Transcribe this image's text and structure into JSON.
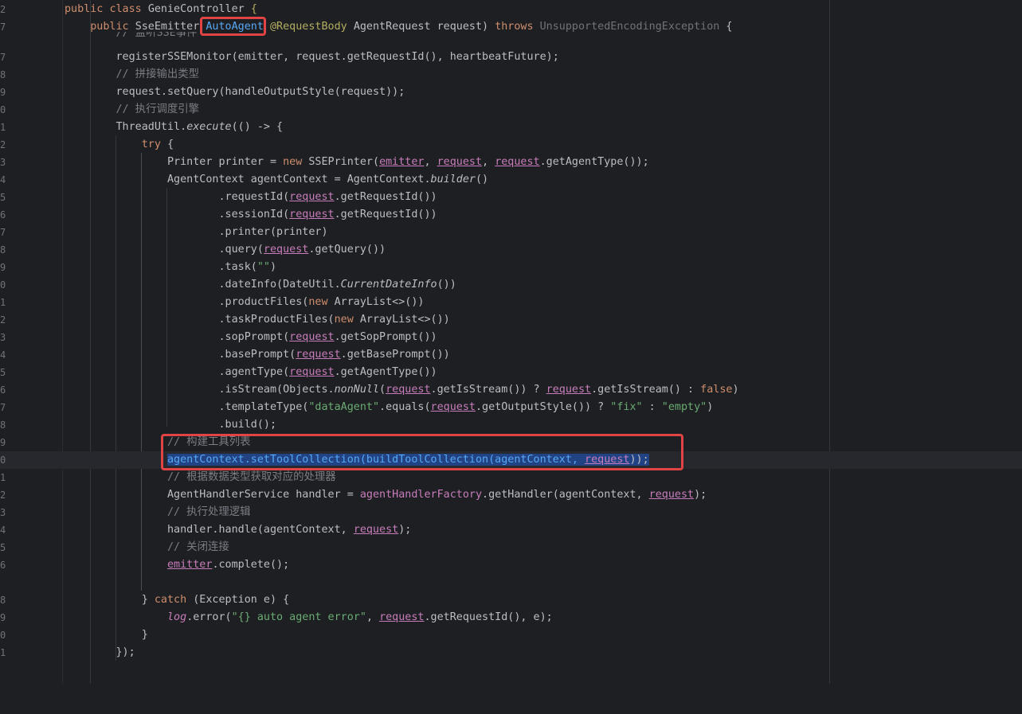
{
  "line_numbers": [
    "2",
    "7",
    "",
    "7",
    "8",
    "9",
    "0",
    "1",
    "2",
    "3",
    "4",
    "5",
    "6",
    "7",
    "8",
    "9",
    "0",
    "1",
    "2",
    "3",
    "4",
    "5",
    "6",
    "7",
    "8",
    "9",
    "0",
    "1",
    "2",
    "3",
    "4",
    "5",
    "6",
    "",
    "8",
    "9",
    "0",
    "1",
    ""
  ],
  "tokens": {
    "l0": [
      "public",
      "class",
      "GenieController",
      "{"
    ],
    "l1": [
      "public",
      "SseEmitter",
      "AutoAgent",
      "@RequestBody",
      "AgentRequest request)",
      "throws",
      "UnsupportedEncodingException",
      "{"
    ],
    "l2": [
      "// 监听SSE事件"
    ],
    "l3": [
      "registerSSEMonitor(emitter, request.getRequestId(), heartbeatFuture);"
    ],
    "l4": [
      "// 拼接输出类型"
    ],
    "l5": [
      "request.setQuery(handleOutputStyle(request));"
    ],
    "l6": [
      "// 执行调度引擎"
    ],
    "l7": [
      "ThreadUtil.",
      "execute",
      "(() -> {"
    ],
    "l8": [
      "try",
      "{"
    ],
    "l9": [
      "Printer printer =",
      "new",
      "SSEPrinter(",
      "emitter",
      ", ",
      "request",
      ", ",
      "request",
      ".getAgentType());"
    ],
    "l10": [
      "AgentContext agentContext = AgentContext.",
      "builder",
      "()"
    ],
    "l11": [
      ".requestId(",
      "request",
      ".getRequestId())"
    ],
    "l12": [
      ".sessionId(",
      "request",
      ".getRequestId())"
    ],
    "l13": [
      ".printer(printer)"
    ],
    "l14": [
      ".query(",
      "request",
      ".getQuery())"
    ],
    "l15": [
      ".task(",
      "\"\"",
      ")"
    ],
    "l16": [
      ".dateInfo(DateUtil.",
      "CurrentDateInfo",
      "())"
    ],
    "l17": [
      ".productFiles(",
      "new",
      "ArrayList<>())"
    ],
    "l18": [
      ".taskProductFiles(",
      "new",
      "ArrayList<>())"
    ],
    "l19": [
      ".sopPrompt(",
      "request",
      ".getSopPrompt())"
    ],
    "l20": [
      ".basePrompt(",
      "request",
      ".getBasePrompt())"
    ],
    "l21": [
      ".agentType(",
      "request",
      ".getAgentType())"
    ],
    "l22": [
      ".isStream(Objects.",
      "nonNull",
      "(",
      "request",
      ".getIsStream()) ? ",
      "request",
      ".getIsStream() : ",
      "false",
      ")"
    ],
    "l23": [
      ".templateType(",
      "\"dataAgent\"",
      ".equals(",
      "request",
      ".getOutputStyle()) ? ",
      "\"fix\"",
      " : ",
      "\"empty\"",
      ")"
    ],
    "l24": [
      ".build();"
    ],
    "l25": [
      "// 构建工具列表"
    ],
    "l26": [
      "agentContext.setToolCollection(buildToolCollection(agentContext, ",
      "request",
      "));"
    ],
    "l27": [
      "// 根据数据类型获取对应的处理器"
    ],
    "l28": [
      "AgentHandlerService handler = ",
      "agentHandlerFactory",
      ".getHandler(agentContext, ",
      "request",
      ");"
    ],
    "l29": [
      "// 执行处理逻辑"
    ],
    "l30": [
      "handler.handle(agentContext, ",
      "request",
      ");"
    ],
    "l31": [
      "// 关闭连接"
    ],
    "l32": [
      "emitter",
      ".complete();"
    ],
    "l34": [
      "}",
      "catch",
      "(Exception e) {"
    ],
    "l35": [
      "log",
      ".error(",
      "\"{} auto agent error\"",
      ", ",
      "request",
      ".getRequestId(), e);"
    ],
    "l36": [
      "}"
    ],
    "l37": [
      "});"
    ]
  },
  "colors": {
    "background": "#1e1f22",
    "keyword": "#cf8e6d",
    "string": "#6aab73",
    "comment": "#7a7e85",
    "method_highlight": "#56a8f5",
    "field": "#c77dbb",
    "annotation": "#b3ae60",
    "selection": "#214283",
    "highlight_box": "#e04444"
  }
}
